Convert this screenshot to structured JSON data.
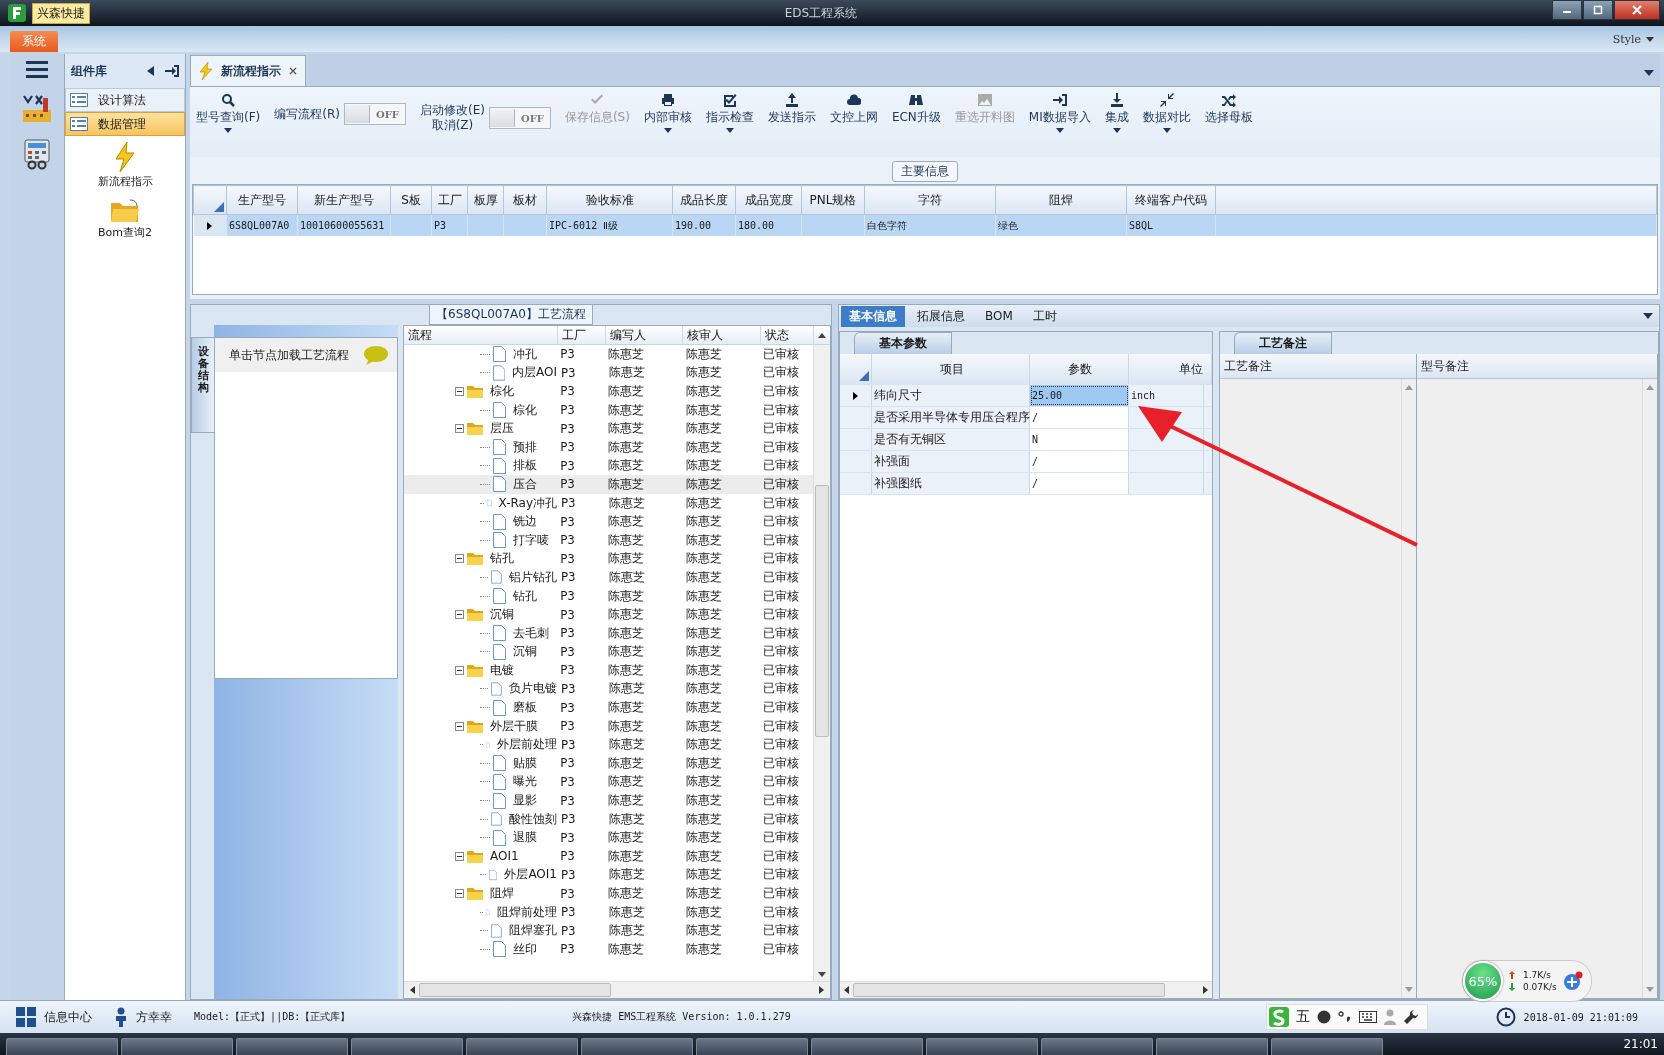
{
  "window": {
    "app_tab": "兴森快捷",
    "title": "EDS工程系统"
  },
  "ribbon": {
    "tabs": [
      {
        "label": "系统",
        "selected": true
      }
    ],
    "style_menu": "Style"
  },
  "component_panel": {
    "title": "组件库",
    "groups": [
      {
        "label": "设计算法",
        "selected": false
      },
      {
        "label": "数据管理",
        "selected": true
      }
    ],
    "launchers": [
      {
        "label": "新流程指示",
        "kind": "bolt"
      },
      {
        "label": "Bom查询2",
        "kind": "folder"
      }
    ]
  },
  "doc_tabs": [
    {
      "label": "新流程指示",
      "selected": true
    }
  ],
  "toolbar": [
    {
      "kind": "button",
      "lines": [
        "型号查询(F)"
      ],
      "dropdown": true,
      "disabled": false
    },
    {
      "kind": "toggle",
      "lines": [
        "编写流程(R)"
      ],
      "on": false,
      "state_text": "OFF"
    },
    {
      "kind": "toggle",
      "lines": [
        "启动修改(E)",
        "取消(Z)"
      ],
      "on": false,
      "state_text": "OFF"
    },
    {
      "kind": "button",
      "lines": [
        "保存信息(S)"
      ],
      "dropdown": false,
      "disabled": true
    },
    {
      "kind": "button",
      "lines": [
        "内部审核"
      ],
      "dropdown": true,
      "disabled": false
    },
    {
      "kind": "button",
      "lines": [
        "指示检查"
      ],
      "dropdown": true,
      "disabled": false
    },
    {
      "kind": "button",
      "lines": [
        "发送指示"
      ],
      "dropdown": false,
      "disabled": false
    },
    {
      "kind": "button",
      "lines": [
        "文控上网"
      ],
      "dropdown": false,
      "disabled": false
    },
    {
      "kind": "button",
      "lines": [
        "ECN升级"
      ],
      "dropdown": false,
      "disabled": false
    },
    {
      "kind": "button",
      "lines": [
        "重选开料图"
      ],
      "dropdown": false,
      "disabled": true
    },
    {
      "kind": "button",
      "lines": [
        "MI数据导入"
      ],
      "dropdown": true,
      "disabled": false
    },
    {
      "kind": "button",
      "lines": [
        "集成"
      ],
      "dropdown": true,
      "disabled": false
    },
    {
      "kind": "button",
      "lines": [
        "数据对比"
      ],
      "dropdown": true,
      "disabled": false
    },
    {
      "kind": "button",
      "lines": [
        "选择母板"
      ],
      "dropdown": false,
      "disabled": false
    }
  ],
  "main_info": {
    "group_title": "主要信息",
    "columns": [
      "生产型号",
      "新生产型号",
      "S板",
      "工厂",
      "板厚",
      "板材",
      "验收标准",
      "成品长度",
      "成品宽度",
      "PNL规格",
      "字符",
      "阻焊",
      "终端客户代码"
    ],
    "rows": [
      {
        "selected": true,
        "cells": [
          "6S8QL007A0",
          "10010600055631",
          null,
          "P3",
          null,
          null,
          "IPC-6012 Ⅱ级",
          "190.00",
          "180.00",
          null,
          "白色字符",
          "绿色",
          "S8QL"
        ]
      }
    ]
  },
  "process": {
    "group_title": "【6S8QL007A0】工艺流程",
    "side_tab": "设备结构",
    "hint": "单击节点加载工艺流程",
    "columns": [
      "流程",
      "工厂",
      "编写人",
      "核审人",
      "状态"
    ],
    "tree": [
      {
        "kind": "step",
        "name": "冲孔",
        "factory": "P3",
        "writer": "陈惠芝",
        "reviewer": "陈惠芝",
        "status": "已审核",
        "selected": false
      },
      {
        "kind": "step",
        "name": "内层AOI",
        "factory": "P3",
        "writer": "陈惠芝",
        "reviewer": "陈惠芝",
        "status": "已审核",
        "selected": false
      },
      {
        "kind": "folder",
        "name": "棕化",
        "factory": "P3",
        "writer": "陈惠芝",
        "reviewer": "陈惠芝",
        "status": "已审核",
        "selected": false,
        "expanded": true,
        "children": [
          {
            "kind": "step",
            "name": "棕化",
            "factory": "P3",
            "writer": "陈惠芝",
            "reviewer": "陈惠芝",
            "status": "已审核",
            "selected": false
          }
        ]
      },
      {
        "kind": "folder",
        "name": "层压",
        "factory": "P3",
        "writer": "陈惠芝",
        "reviewer": "陈惠芝",
        "status": "已审核",
        "selected": false,
        "expanded": true,
        "children": [
          {
            "kind": "step",
            "name": "预排",
            "factory": "P3",
            "writer": "陈惠芝",
            "reviewer": "陈惠芝",
            "status": "已审核",
            "selected": false
          },
          {
            "kind": "step",
            "name": "排板",
            "factory": "P3",
            "writer": "陈惠芝",
            "reviewer": "陈惠芝",
            "status": "已审核",
            "selected": false
          },
          {
            "kind": "step",
            "name": "压合",
            "factory": "P3",
            "writer": "陈惠芝",
            "reviewer": "陈惠芝",
            "status": "已审核",
            "selected": true
          },
          {
            "kind": "step",
            "name": "X-Ray冲孔",
            "factory": "P3",
            "writer": "陈惠芝",
            "reviewer": "陈惠芝",
            "status": "已审核",
            "selected": false
          },
          {
            "kind": "step",
            "name": "铣边",
            "factory": "P3",
            "writer": "陈惠芝",
            "reviewer": "陈惠芝",
            "status": "已审核",
            "selected": false
          },
          {
            "kind": "step",
            "name": "打字唛",
            "factory": "P3",
            "writer": "陈惠芝",
            "reviewer": "陈惠芝",
            "status": "已审核",
            "selected": false
          }
        ]
      },
      {
        "kind": "folder",
        "name": "钻孔",
        "factory": "P3",
        "writer": "陈惠芝",
        "reviewer": "陈惠芝",
        "status": "已审核",
        "selected": false,
        "expanded": true,
        "children": [
          {
            "kind": "step",
            "name": "铝片钻孔",
            "factory": "P3",
            "writer": "陈惠芝",
            "reviewer": "陈惠芝",
            "status": "已审核",
            "selected": false
          },
          {
            "kind": "step",
            "name": "钻孔",
            "factory": "P3",
            "writer": "陈惠芝",
            "reviewer": "陈惠芝",
            "status": "已审核",
            "selected": false
          }
        ]
      },
      {
        "kind": "folder",
        "name": "沉铜",
        "factory": "P3",
        "writer": "陈惠芝",
        "reviewer": "陈惠芝",
        "status": "已审核",
        "selected": false,
        "expanded": true,
        "children": [
          {
            "kind": "step",
            "name": "去毛刺",
            "factory": "P3",
            "writer": "陈惠芝",
            "reviewer": "陈惠芝",
            "status": "已审核",
            "selected": false
          },
          {
            "kind": "step",
            "name": "沉铜",
            "factory": "P3",
            "writer": "陈惠芝",
            "reviewer": "陈惠芝",
            "status": "已审核",
            "selected": false
          }
        ]
      },
      {
        "kind": "folder",
        "name": "电镀",
        "factory": "P3",
        "writer": "陈惠芝",
        "reviewer": "陈惠芝",
        "status": "已审核",
        "selected": false,
        "expanded": true,
        "children": [
          {
            "kind": "step",
            "name": "负片电镀",
            "factory": "P3",
            "writer": "陈惠芝",
            "reviewer": "陈惠芝",
            "status": "已审核",
            "selected": false
          },
          {
            "kind": "step",
            "name": "磨板",
            "factory": "P3",
            "writer": "陈惠芝",
            "reviewer": "陈惠芝",
            "status": "已审核",
            "selected": false
          }
        ]
      },
      {
        "kind": "folder",
        "name": "外层干膜",
        "factory": "P3",
        "writer": "陈惠芝",
        "reviewer": "陈惠芝",
        "status": "已审核",
        "selected": false,
        "expanded": true,
        "children": [
          {
            "kind": "step",
            "name": "外层前处理",
            "factory": "P3",
            "writer": "陈惠芝",
            "reviewer": "陈惠芝",
            "status": "已审核",
            "selected": false
          },
          {
            "kind": "step",
            "name": "贴膜",
            "factory": "P3",
            "writer": "陈惠芝",
            "reviewer": "陈惠芝",
            "status": "已审核",
            "selected": false
          },
          {
            "kind": "step",
            "name": "曝光",
            "factory": "P3",
            "writer": "陈惠芝",
            "reviewer": "陈惠芝",
            "status": "已审核",
            "selected": false
          },
          {
            "kind": "step",
            "name": "显影",
            "factory": "P3",
            "writer": "陈惠芝",
            "reviewer": "陈惠芝",
            "status": "已审核",
            "selected": false
          },
          {
            "kind": "step",
            "name": "酸性蚀刻",
            "factory": "P3",
            "writer": "陈惠芝",
            "reviewer": "陈惠芝",
            "status": "已审核",
            "selected": false
          },
          {
            "kind": "step",
            "name": "退膜",
            "factory": "P3",
            "writer": "陈惠芝",
            "reviewer": "陈惠芝",
            "status": "已审核",
            "selected": false
          }
        ]
      },
      {
        "kind": "folder",
        "name": "AOI1",
        "factory": "P3",
        "writer": "陈惠芝",
        "reviewer": "陈惠芝",
        "status": "已审核",
        "selected": false,
        "expanded": true,
        "children": [
          {
            "kind": "step",
            "name": "外层AOI1",
            "factory": "P3",
            "writer": "陈惠芝",
            "reviewer": "陈惠芝",
            "status": "已审核",
            "selected": false
          }
        ]
      },
      {
        "kind": "folder",
        "name": "阻焊",
        "factory": "P3",
        "writer": "陈惠芝",
        "reviewer": "陈惠芝",
        "status": "已审核",
        "selected": false,
        "expanded": true,
        "children": [
          {
            "kind": "step",
            "name": "阻焊前处理",
            "factory": "P3",
            "writer": "陈惠芝",
            "reviewer": "陈惠芝",
            "status": "已审核",
            "selected": false
          },
          {
            "kind": "step",
            "name": "阻焊塞孔",
            "factory": "P3",
            "writer": "陈惠芝",
            "reviewer": "陈惠芝",
            "status": "已审核",
            "selected": false
          },
          {
            "kind": "step",
            "name": "丝印",
            "factory": "P3",
            "writer": "陈惠芝",
            "reviewer": "陈惠芝",
            "status": "已审核",
            "selected": false
          }
        ]
      }
    ]
  },
  "details": {
    "tabs": [
      {
        "label": "基本信息",
        "selected": true
      },
      {
        "label": "拓展信息",
        "selected": false
      },
      {
        "label": "BOM",
        "selected": false
      },
      {
        "label": "工时",
        "selected": false
      }
    ],
    "params": {
      "group_title": "基本参数",
      "columns": [
        "项目",
        "参数",
        "单位"
      ],
      "rows": [
        {
          "item": "纬向尺寸",
          "value": "25.00",
          "unit": "inch",
          "selected": true
        },
        {
          "item": "是否采用半导体专用压合程序",
          "value": "/",
          "unit": null,
          "selected": false
        },
        {
          "item": "是否有无铜区",
          "value": "N",
          "unit": null,
          "selected": false
        },
        {
          "item": "补强面",
          "value": "/",
          "unit": null,
          "selected": false
        },
        {
          "item": "补强图纸",
          "value": "/",
          "unit": null,
          "selected": false
        }
      ]
    },
    "notes": {
      "group_title": "工艺备注",
      "columns": [
        "工艺备注",
        "型号备注"
      ]
    }
  },
  "net_widget": {
    "usage": "65%",
    "upload": "1.7K/s",
    "download": "0.07K/s"
  },
  "status_bar": {
    "info_center": "信息中心",
    "user": "方幸幸",
    "model_db": "Model:【正式】||DB:【正式库】",
    "version": "兴森快捷 EMS工程系统 Version: 1.0.1.279",
    "ime_mode": "五",
    "datetime": "2018-01-09 21:01:09"
  },
  "taskbar": {
    "clock": "21:01"
  }
}
